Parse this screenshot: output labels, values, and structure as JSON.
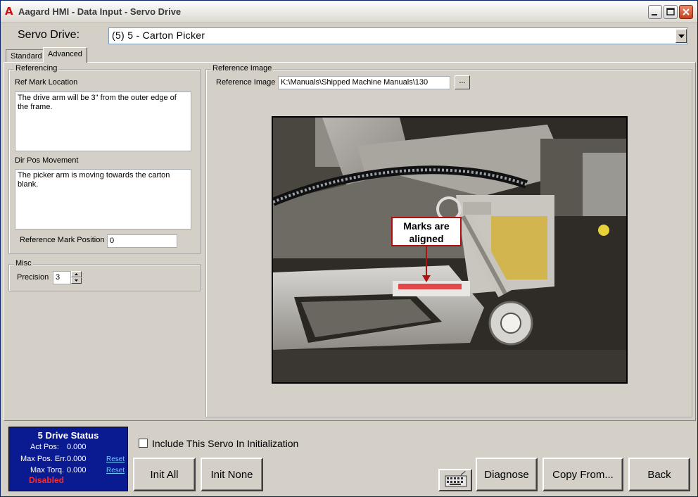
{
  "window": {
    "title": "Aagard HMI - Data Input - Servo Drive",
    "app_icon_letter": "A"
  },
  "header": {
    "servo_label": "Servo Drive:",
    "servo_selected": "(5) 5 - Carton Picker"
  },
  "tabs": [
    {
      "label": "Standard",
      "active": false
    },
    {
      "label": "Advanced",
      "active": true
    }
  ],
  "referencing": {
    "group_title": "Referencing",
    "ref_mark_location_label": "Ref Mark Location",
    "ref_mark_location_value": "The drive arm will be 3\" from the outer edge of the frame.",
    "dir_pos_movement_label": "Dir Pos Movement",
    "dir_pos_movement_value": "The picker arm is moving towards the carton blank.",
    "ref_mark_position_label": "Reference Mark Position",
    "ref_mark_position_value": "0"
  },
  "misc": {
    "group_title": "Misc",
    "precision_label": "Precision",
    "precision_value": "3"
  },
  "reference_image": {
    "group_title": "Reference Image",
    "field_label": "Reference Image",
    "path_value": "K:\\Manuals\\Shipped Machine Manuals\\130",
    "browse_label": "...",
    "callout_text": "Marks are aligned"
  },
  "status": {
    "title": "5 Drive Status",
    "act_pos_label": "Act Pos:",
    "act_pos_value": "0.000",
    "max_pos_err_label": "Max Pos. Err.",
    "max_pos_err_value": "0.000",
    "max_torq_label": "Max Torq.",
    "max_torq_value": "0.000",
    "reset_label": "Reset",
    "state": "Disabled"
  },
  "init": {
    "include_label": "Include This Servo In Initialization",
    "checked": false
  },
  "buttons": {
    "init_all": "Init All",
    "init_none": "Init None",
    "diagnose": "Diagnose",
    "copy_from": "Copy From...",
    "back": "Back"
  },
  "colors": {
    "status_bg": "#0a1a90",
    "disabled_text": "#ff2a2a",
    "callout_border": "#b01010"
  }
}
